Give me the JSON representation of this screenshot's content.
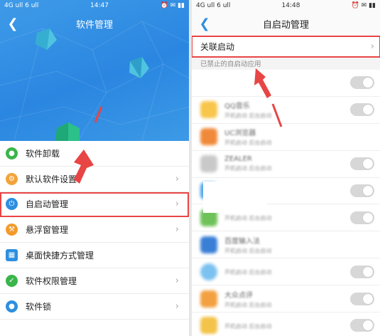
{
  "left_screen": {
    "status": {
      "carrier": "4G ull 6 ull",
      "time": "14:47",
      "indicators": "⏰ ✉ ▮▮"
    },
    "title": "软件管理",
    "menu": [
      {
        "label": "软件卸载",
        "icon": "android-icon",
        "color": "#3ab54a"
      },
      {
        "label": "默认软件设置",
        "icon": "gear-icon",
        "color": "#f3a33a"
      },
      {
        "label": "自启动管理",
        "icon": "power-icon",
        "color": "#2d8fe0",
        "highlighted": true
      },
      {
        "label": "悬浮窗管理",
        "icon": "wrench-icon",
        "color": "#f39a2a"
      },
      {
        "label": "桌面快捷方式管理",
        "icon": "grid-icon",
        "color": "#2d8fe0"
      },
      {
        "label": "软件权限管理",
        "icon": "shield-icon",
        "color": "#3ab54a"
      },
      {
        "label": "软件锁",
        "icon": "lock-icon",
        "color": "#2d8fe0"
      }
    ]
  },
  "right_screen": {
    "status": {
      "carrier": "4G ull 6 ull",
      "time": "14:48",
      "indicators": "⏰ ✉ ▮▮"
    },
    "title": "自启动管理",
    "associated_start": "关联启动",
    "section_label": "已禁止的自启动应用",
    "apps": [
      {
        "name": "",
        "sub": "",
        "color": "#ffffff"
      },
      {
        "name": "QQ音乐",
        "sub": "开机启动   后台启动",
        "color": "#f7c64b"
      },
      {
        "name": "UC浏览器",
        "sub": "开机启动   后台启动",
        "color": "#f08a3a"
      },
      {
        "name": "ZEALER",
        "sub": "开机启动   后台启动",
        "color": "#c9c9c9"
      },
      {
        "name": "",
        "sub": "",
        "color": "#4aa3e8"
      },
      {
        "name": "",
        "sub": "开机启动   后台启动",
        "color": "#6fc25a"
      },
      {
        "name": "百度输入法",
        "sub": "开机启动   后台启动",
        "color": "#3a7fd6"
      },
      {
        "name": "",
        "sub": "开机启动   后台启动",
        "color": "#7cc2f0"
      },
      {
        "name": "大众点评",
        "sub": "开机启动   后台启动",
        "color": "#f2a040"
      },
      {
        "name": "",
        "sub": "开机启动   后台启动",
        "color": "#f3c34a"
      }
    ]
  },
  "annotation_color": "#e84545"
}
